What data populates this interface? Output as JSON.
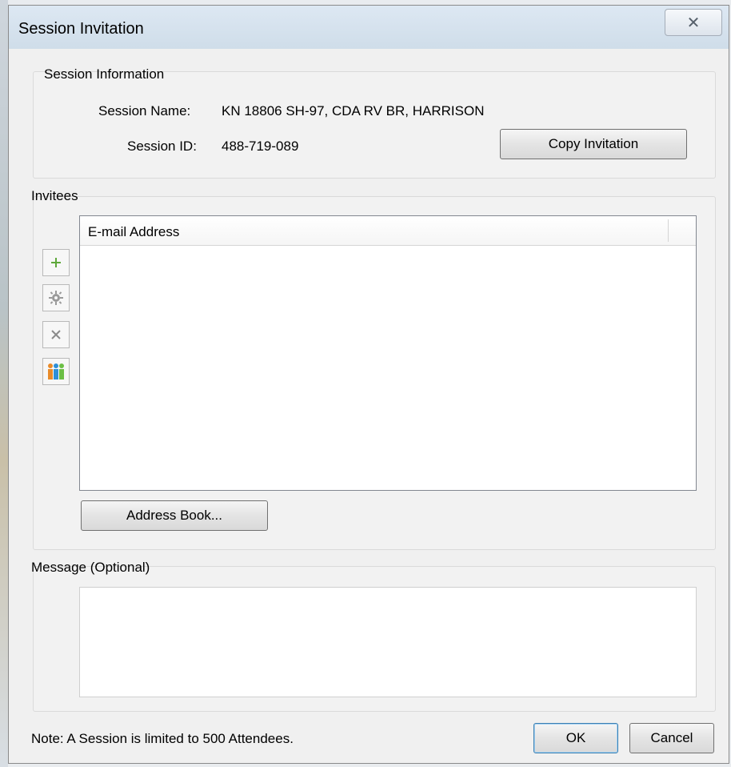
{
  "window": {
    "title": "Session Invitation"
  },
  "session_info": {
    "group_label": "Session Information",
    "name_label": "Session Name:",
    "name_value": "KN 18806 SH-97, CDA RV BR, HARRISON",
    "id_label": "Session ID:",
    "id_value": "488-719-089",
    "copy_button": "Copy Invitation"
  },
  "invitees": {
    "group_label": "Invitees",
    "column_header": "E-mail Address",
    "address_book_button": "Address Book..."
  },
  "message": {
    "group_label": "Message (Optional)",
    "value": ""
  },
  "footer": {
    "note": "Note: A Session is limited to 500 Attendees.",
    "ok": "OK",
    "cancel": "Cancel"
  },
  "icons": {
    "add": "plus-icon",
    "edit": "gear-icon",
    "remove": "x-icon",
    "people": "people-icon"
  }
}
